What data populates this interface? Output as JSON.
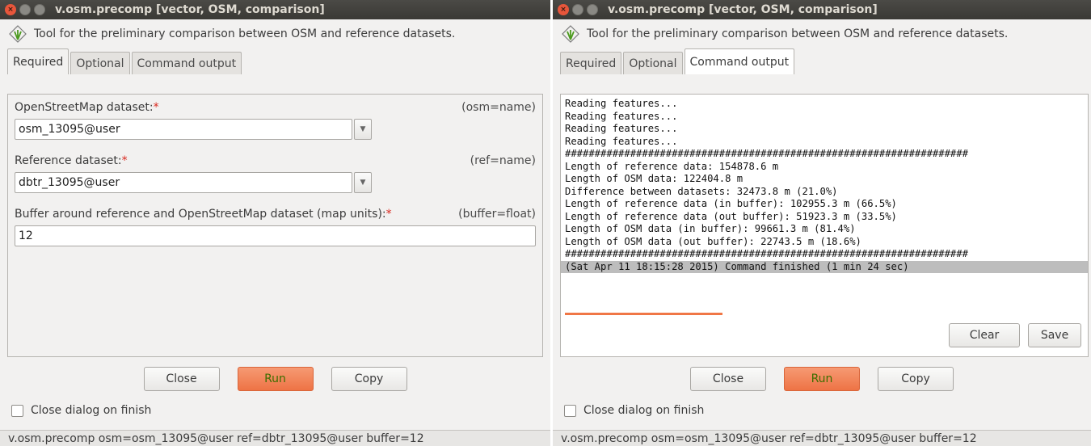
{
  "left": {
    "title": "v.osm.precomp [vector, OSM, comparison]",
    "description": "Tool for the preliminary comparison between OSM and reference datasets.",
    "tabs": [
      "Required",
      "Optional",
      "Command output"
    ],
    "fields": [
      {
        "label": "OpenStreetMap dataset:",
        "required_mark": "*",
        "key": "(osm=name)",
        "value": "osm_13095@user"
      },
      {
        "label": "Reference dataset:",
        "required_mark": "*",
        "key": "(ref=name)",
        "value": "dbtr_13095@user"
      },
      {
        "label": "Buffer around reference and OpenStreetMap dataset (map units):",
        "required_mark": "*",
        "key": "(buffer=float)",
        "value": "12"
      }
    ],
    "buttons": {
      "close": "Close",
      "run": "Run",
      "copy": "Copy"
    },
    "checkbox_label": "Close dialog on finish",
    "status": "v.osm.precomp osm=osm_13095@user ref=dbtr_13095@user buffer=12"
  },
  "right": {
    "title": "v.osm.precomp [vector, OSM, comparison]",
    "description": "Tool for the preliminary comparison between OSM and reference datasets.",
    "tabs": [
      "Required",
      "Optional",
      "Command output"
    ],
    "output_lines": [
      "Reading features...",
      "Reading features...",
      "Reading features...",
      "Reading features...",
      "####################################################################",
      "Length of reference data: 154878.6 m",
      "Length of OSM data: 122404.8 m",
      "Difference between datasets: 32473.8 m (21.0%)",
      "Length of reference data (in buffer): 102955.3 m (66.5%)",
      "Length of reference data (out buffer): 51923.3 m (33.5%)",
      "Length of OSM data (in buffer): 99661.3 m (81.4%)",
      "Length of OSM data (out buffer): 22743.5 m (18.6%)",
      "####################################################################"
    ],
    "finished_line": "(Sat Apr 11 18:15:28 2015) Command finished (1 min 24 sec)",
    "panel_buttons": {
      "clear": "Clear",
      "save": "Save"
    },
    "buttons": {
      "close": "Close",
      "run": "Run",
      "copy": "Copy"
    },
    "checkbox_label": "Close dialog on finish",
    "status": "v.osm.precomp osm=osm_13095@user ref=dbtr_13095@user buffer=12"
  },
  "icons": [
    "close-icon",
    "minimize-icon",
    "maximize-icon",
    "grass-logo-icon",
    "chevron-down-icon"
  ],
  "colors": {
    "run_button": "#ee7345",
    "required_mark": "#d9281e",
    "titlebar": "#3c3b37",
    "progress": "#f07746"
  }
}
